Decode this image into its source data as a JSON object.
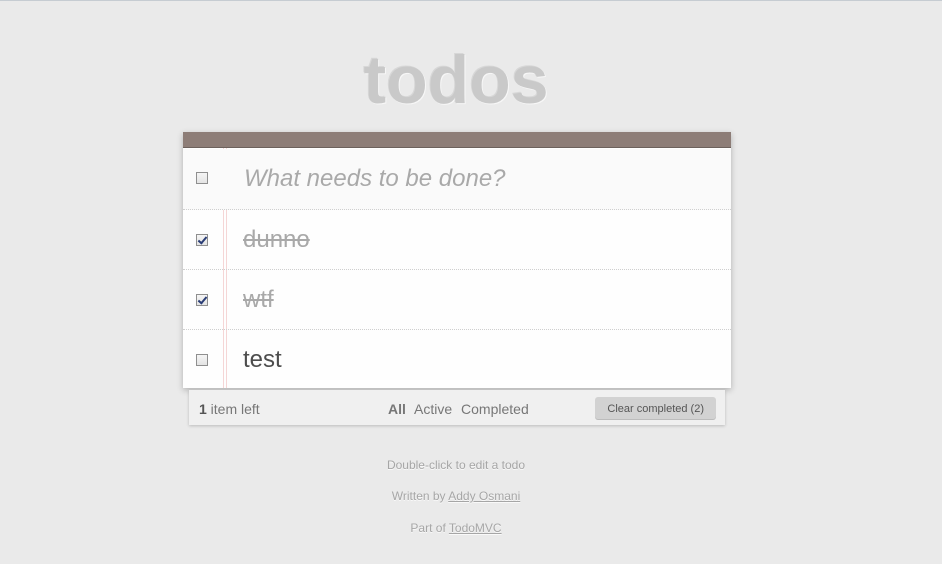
{
  "app": {
    "title": "todos"
  },
  "new_todo": {
    "placeholder": "What needs to be done?",
    "value": ""
  },
  "todos": [
    {
      "label": "dunno",
      "completed": true
    },
    {
      "label": "wtf",
      "completed": true
    },
    {
      "label": "test",
      "completed": false
    }
  ],
  "footer": {
    "count": "1",
    "count_suffix": " item left",
    "filters": [
      {
        "label": "All",
        "selected": true
      },
      {
        "label": "Active",
        "selected": false
      },
      {
        "label": "Completed",
        "selected": false
      }
    ],
    "clear_label": "Clear completed (2)"
  },
  "info": {
    "hint": "Double-click to edit a todo",
    "written_by_prefix": "Written by ",
    "author": "Addy Osmani",
    "part_of_prefix": "Part of ",
    "project": "TodoMVC"
  },
  "colors": {
    "background": "#eaeaea",
    "header_bar": "#8d7d77",
    "title": "#c9c9c9",
    "completed_text": "#a9a9a9",
    "checkbox_check": "#2a3d75"
  }
}
